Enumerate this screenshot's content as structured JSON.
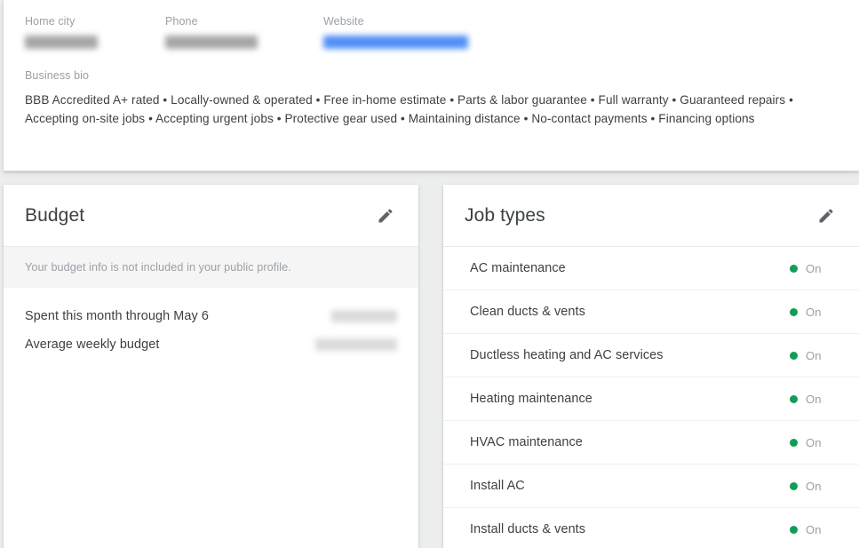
{
  "profile": {
    "fields": [
      {
        "label": "Home city",
        "value": "",
        "redacted": true,
        "style": "gray"
      },
      {
        "label": "Phone",
        "value": "",
        "redacted": true,
        "style": "gray"
      },
      {
        "label": "Website",
        "value": "",
        "redacted": true,
        "style": "blue"
      }
    ],
    "bio_label": "Business bio",
    "bio_text": "BBB Accredited A+ rated • Locally-owned & operated • Free in-home estimate • Parts & labor guarantee • Full warranty • Guaranteed repairs • Accepting on-site jobs • Accepting urgent jobs • Protective gear used • Maintaining distance • No-contact payments • Financing options"
  },
  "budget": {
    "title": "Budget",
    "edit_icon": "pencil-icon",
    "notice": "Your budget info is not included in your public profile.",
    "rows": [
      {
        "label": "Spent this month through May 6",
        "value": ""
      },
      {
        "label": "Average weekly budget",
        "value": ""
      }
    ]
  },
  "job_types": {
    "title": "Job types",
    "edit_icon": "pencil-icon",
    "status_on_label": "On",
    "status_on_color": "#0f9d58",
    "items": [
      {
        "name": "AC maintenance",
        "status": "On"
      },
      {
        "name": "Clean ducts & vents",
        "status": "On"
      },
      {
        "name": "Ductless heating and AC services",
        "status": "On"
      },
      {
        "name": "Heating maintenance",
        "status": "On"
      },
      {
        "name": "HVAC maintenance",
        "status": "On"
      },
      {
        "name": "Install AC",
        "status": "On"
      },
      {
        "name": "Install ducts & vents",
        "status": "On"
      }
    ]
  }
}
